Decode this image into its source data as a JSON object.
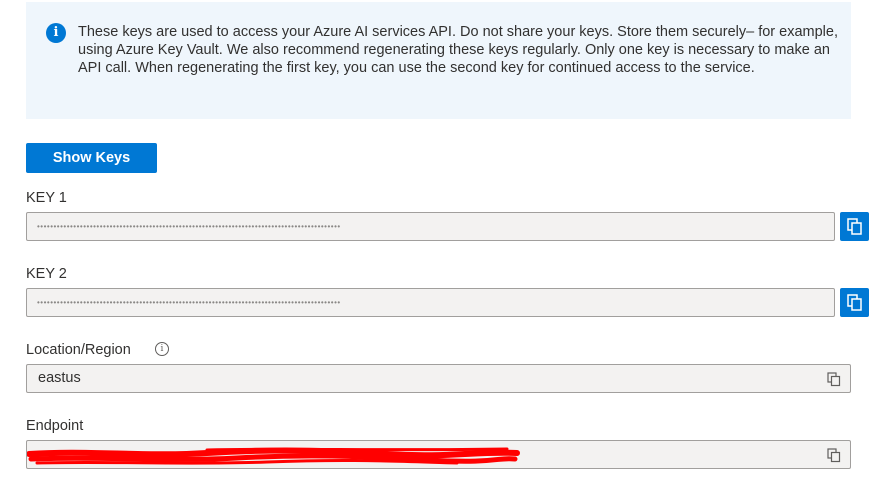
{
  "info": {
    "text": "These keys are used to access your Azure AI services API. Do not share your keys. Store them securely– for example, using Azure Key Vault. We also recommend regenerating these keys regularly. Only one key is necessary to make an API call. When regenerating the first key, you can use the second key for continued access to the service.",
    "icon": "info-icon"
  },
  "show_keys_label": "Show Keys",
  "key1": {
    "label": "KEY 1",
    "value": "••••••••••••••••••••••••••••••••••••••••••••••••••••••••••••••••••••••••••••••••••••••••••••"
  },
  "key2": {
    "label": "KEY 2",
    "value": "••••••••••••••••••••••••••••••••••••••••••••••••••••••••••••••••••••••••••••••••••••••••••••"
  },
  "location": {
    "label": "Location/Region",
    "value": "eastus"
  },
  "endpoint": {
    "label": "Endpoint",
    "value": ""
  },
  "colors": {
    "accent": "#0078d4",
    "banner_bg": "#eff6fc",
    "field_bg": "#f3f2f1",
    "redaction": "#ff0000"
  }
}
